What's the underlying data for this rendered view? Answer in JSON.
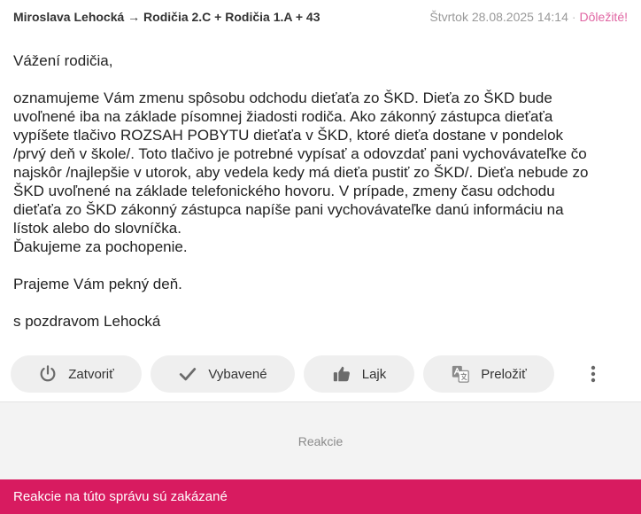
{
  "header": {
    "recipients": "Miroslava Lehocká → Rodičia 2.C + Rodičia 1.A + 43",
    "datetime": "Štvrtok 28.08.2025 14:14",
    "separator": "·",
    "important_label": "Dôležité!"
  },
  "message": {
    "greeting": "Vážení rodičia,",
    "lines": [
      "oznamujeme Vám zmenu spôsobu odchodu dieťaťa zo ŠKD. Dieťa zo ŠKD bude",
      "uvoľnené iba na základe písomnej žiadosti rodiča. Ako zákonný zástupca dieťaťa",
      "vypíšete tlačivo ROZSAH POBYTU dieťaťa v ŠKD, ktoré dieťa dostane v pondelok",
      "/prvý deň v škole/. Toto tlačivo je potrebné vypísať a odovzdať pani vychovávateľke čo",
      "najskôr /najlepšie v utorok, aby vedela kedy má dieťa pustiť zo ŠKD/. Dieťa nebude zo",
      "ŠKD uvoľnené na základe telefonického hovoru. V prípade, zmeny času odchodu",
      "dieťaťa zo ŠKD zákonný zástupca napíše pani vychovávateľke danú informáciu na",
      "lístok alebo do slovníčka.",
      "Ďakujeme za pochopenie."
    ],
    "wish": "Prajeme Vám pekný deň.",
    "signature": "s pozdravom Lehocká"
  },
  "actions": {
    "close_label": "Zatvoriť",
    "done_label": "Vybavené",
    "like_label": "Lajk",
    "translate_label": "Preložiť"
  },
  "reactions": {
    "label": "Reakcie"
  },
  "footer": {
    "notice": "Reakcie na túto správu sú zakázané"
  },
  "colors": {
    "accent": "#d81b60",
    "important": "#e066a3",
    "button_bg": "#efefef"
  }
}
